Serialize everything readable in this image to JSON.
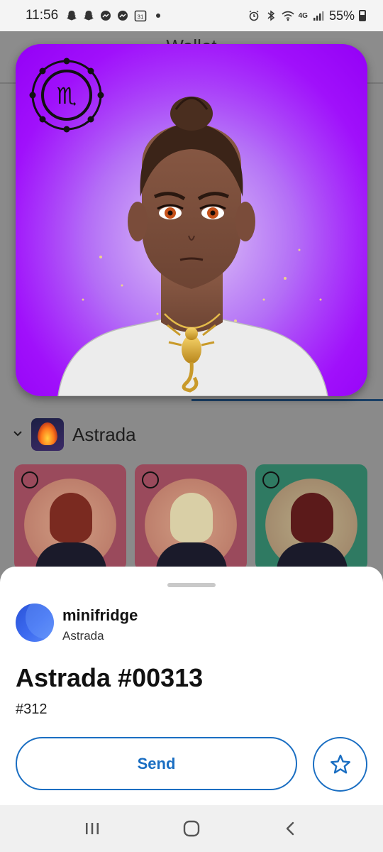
{
  "status_bar": {
    "time": "11:56",
    "left_icons": [
      "snapchat-icon",
      "snapchat-icon",
      "messenger-icon",
      "messenger-icon",
      "calendar-icon",
      "dot-icon"
    ],
    "calendar_day": "31",
    "network_label": "4G",
    "battery_percent": "55%",
    "right_icons": [
      "alarm-icon",
      "bluetooth-icon",
      "wifi-icon",
      "signal-icon",
      "battery-icon"
    ]
  },
  "background_app": {
    "title": "Wallet",
    "collection": {
      "name": "Astrada",
      "collapse_icon": "chevron-down-icon"
    },
    "nft_cards": [
      {
        "accent": "#9a4a5c"
      },
      {
        "accent": "#9a4a5c"
      },
      {
        "accent": "#2f7a62"
      }
    ]
  },
  "featured_nft": {
    "background_color": "#a010fb",
    "zodiac_symbol": "♏"
  },
  "sheet": {
    "owner_name": "minifridge",
    "owner_collection": "Astrada",
    "nft_title": "Astrada #00313",
    "nft_number": "#312",
    "send_label": "Send",
    "favorite_icon": "star-icon"
  },
  "nav_bar": {
    "icons": [
      "recent-apps-icon",
      "home-icon",
      "back-icon"
    ]
  },
  "colors": {
    "accent_blue": "#1a6ec2",
    "scrim": "#8a8a8a",
    "featured_purple": "#a010fb"
  }
}
